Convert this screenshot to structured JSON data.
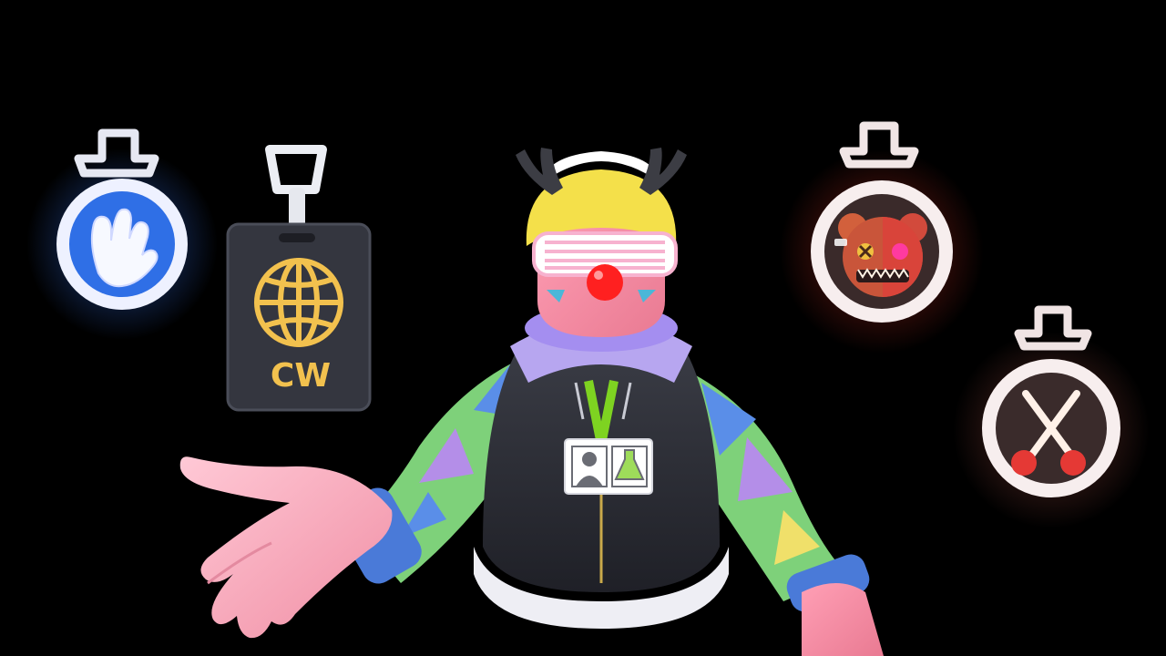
{
  "scene": {
    "background": "#000000"
  },
  "badges": [
    {
      "id": "wave",
      "icon": "waving-hand-icon",
      "glow": "#3a7bff",
      "face": "#2f6fe6"
    },
    {
      "id": "cw",
      "icon": "globe-icon",
      "label": "CW",
      "face": "#34363f",
      "accent": "#f2c14e"
    },
    {
      "id": "bear",
      "icon": "bear-face-icon",
      "glow": "#ff3a2a",
      "face": "#3a2a2a"
    },
    {
      "id": "cross",
      "icon": "crossed-bones-icon",
      "glow": "#ff6a5a",
      "face": "#3a2b2b"
    }
  ],
  "character": {
    "name_tag_icons": [
      "person-silhouette-icon",
      "flask-icon"
    ],
    "lanyard_color": "#7ed321",
    "nose_color": "#ff2020"
  }
}
